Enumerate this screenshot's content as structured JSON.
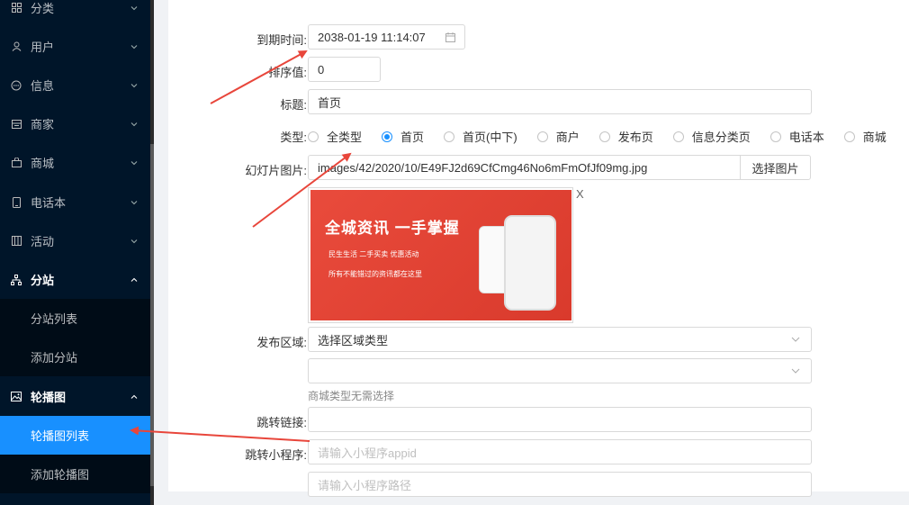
{
  "sidebar": {
    "items": [
      {
        "label": "分类",
        "icon": "grid-icon"
      },
      {
        "label": "用户",
        "icon": "user-icon"
      },
      {
        "label": "信息",
        "icon": "chat-icon"
      },
      {
        "label": "商家",
        "icon": "store-icon"
      },
      {
        "label": "商城",
        "icon": "bag-icon"
      },
      {
        "label": "电话本",
        "icon": "phone-icon"
      },
      {
        "label": "活动",
        "icon": "calendar-icon"
      },
      {
        "label": "分站",
        "icon": "sitemap-icon"
      },
      {
        "label": "轮播图",
        "icon": "image-icon"
      }
    ],
    "substation_subitems": [
      "分站列表",
      "添加分站"
    ],
    "carousel_subitems": [
      "轮播图列表",
      "添加轮播图"
    ]
  },
  "form": {
    "expire_label": "到期时间:",
    "expire_value": "2038-01-19 11:14:07",
    "sort_label": "排序值:",
    "sort_value": "0",
    "title_label": "标题:",
    "title_value": "首页",
    "type_label": "类型:",
    "type_options": [
      "全类型",
      "首页",
      "首页(中下)",
      "商户",
      "发布页",
      "信息分类页",
      "电话本",
      "商城"
    ],
    "type_selected": "首页",
    "slide_label": "幻灯片图片:",
    "slide_value": "images/42/2020/10/E49FJ2d69CfCmg46No6mFmOfJf09mg.jpg",
    "slide_button": "选择图片",
    "banner_title": "全城资讯 一手掌握",
    "banner_line1": "民生生活  二手买卖  优惠活动",
    "banner_line2": "所有不能错过的资讯都在这里",
    "close_symbol": "X",
    "region_label": "发布区域:",
    "region_select": "选择区域类型",
    "region_hint": "商城类型无需选择",
    "jump_link_label": "跳转链接:",
    "jump_mini_label": "跳转小程序:",
    "appid_placeholder": "请输入小程序appid",
    "path_placeholder": "请输入小程序路径"
  },
  "colors": {
    "sidebar_bg": "#001529",
    "sidebar_sub_bg": "#000c17",
    "active_item": "#1890ff",
    "annotation_arrow": "#e8463b"
  }
}
